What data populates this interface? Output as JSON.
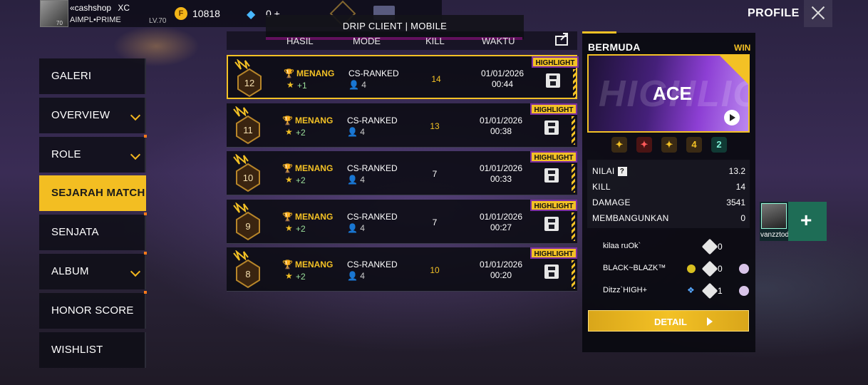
{
  "player": {
    "name": "«cashshop",
    "tag": "XC",
    "clan": "AIMPL•PRIME",
    "level": "LV.70",
    "avatar_level": "70"
  },
  "currency": {
    "gold_icon": "F",
    "gold": "10818",
    "diamonds": "0 +"
  },
  "banner": {
    "text": "DRIP CLIENT | MOBILE"
  },
  "page_title": "PROFILE",
  "sidebar": {
    "items": [
      {
        "label": "GALERI"
      },
      {
        "label": "OVERVIEW"
      },
      {
        "label": "ROLE"
      },
      {
        "label": "SEJARAH MATCH"
      },
      {
        "label": "SENJATA"
      },
      {
        "label": "ALBUM"
      },
      {
        "label": "HONOR SCORE"
      },
      {
        "label": "WISHLIST"
      }
    ],
    "active": "SEJARAH MATCH"
  },
  "table": {
    "headers": {
      "result": "HASIL",
      "mode": "MODE",
      "kill": "KILL",
      "time": "WAKTU"
    },
    "rows": [
      {
        "rank": "12",
        "result": "MENANG",
        "points": "+1",
        "mode": "CS-RANKED",
        "squad": "4",
        "kill": "14",
        "date": "01/01/2026",
        "time": "00:44",
        "tag": "HIGHLIGHT"
      },
      {
        "rank": "11",
        "result": "MENANG",
        "points": "+2",
        "mode": "CS-RANKED",
        "squad": "4",
        "kill": "13",
        "date": "01/01/2026",
        "time": "00:38",
        "tag": "HIGHLIGHT"
      },
      {
        "rank": "10",
        "result": "MENANG",
        "points": "+2",
        "mode": "CS-RANKED",
        "squad": "4",
        "kill": "7",
        "date": "01/01/2026",
        "time": "00:33",
        "tag": "HIGHLIGHT"
      },
      {
        "rank": "9",
        "result": "MENANG",
        "points": "+2",
        "mode": "CS-RANKED",
        "squad": "4",
        "kill": "7",
        "date": "01/01/2026",
        "time": "00:27",
        "tag": "HIGHLIGHT"
      },
      {
        "rank": "8",
        "result": "MENANG",
        "points": "+2",
        "mode": "CS-RANKED",
        "squad": "4",
        "kill": "10",
        "date": "01/01/2026",
        "time": "00:20",
        "tag": "HIGHLIGHT"
      }
    ]
  },
  "detail_panel": {
    "map": "BERMUDA",
    "outcome": "WIN",
    "highlight_bg": "HIGHLIGHT",
    "highlight": "ACE",
    "medals": [
      "4",
      "2"
    ],
    "stats": [
      {
        "label": "NILAI",
        "value": "13.2"
      },
      {
        "label": "KILL",
        "value": "14"
      },
      {
        "label": "DAMAGE",
        "value": "3541"
      },
      {
        "label": "MEMBANGUNKAN",
        "value": "0"
      }
    ],
    "teammates": [
      {
        "name": "kilaa ruOk`",
        "value": "0"
      },
      {
        "name": "BLACK~BLAZK™",
        "value": "0"
      },
      {
        "name": "Ditzz`HIGH+",
        "value": "1"
      }
    ],
    "detail_button": "DETAIL"
  },
  "friend": {
    "name": "vanzztod~",
    "add": "+"
  },
  "colors": {
    "accent": "#f3c125",
    "banner_line": "#e61ad0",
    "active_nav": "#f3be22",
    "friend_add": "#1e6d56"
  }
}
